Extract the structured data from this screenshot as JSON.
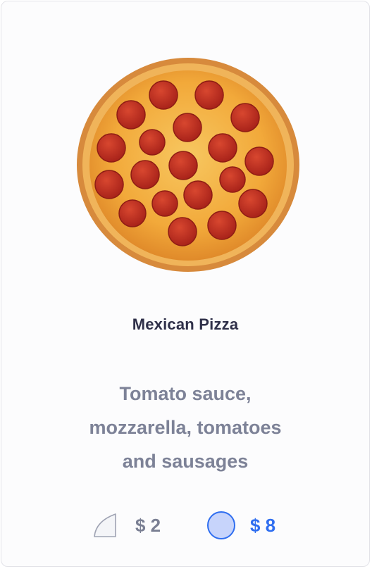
{
  "product": {
    "name": "Mexican Pizza",
    "image_icon": "pepperoni-pizza-image",
    "description_lines": [
      "Tomato sauce,",
      "mozzarella, tomatoes",
      "and sausages"
    ]
  },
  "options": [
    {
      "icon": "pizza-slice-icon",
      "price": "$ 2",
      "selected": false
    },
    {
      "icon": "whole-pizza-icon",
      "price": "$ 8",
      "selected": true
    }
  ],
  "colors": {
    "title": "#2f3049",
    "description": "#7d8297",
    "selected_accent": "#2f6ef0",
    "selected_fill": "#c7d4fb",
    "unselected": "#7a7f93"
  }
}
